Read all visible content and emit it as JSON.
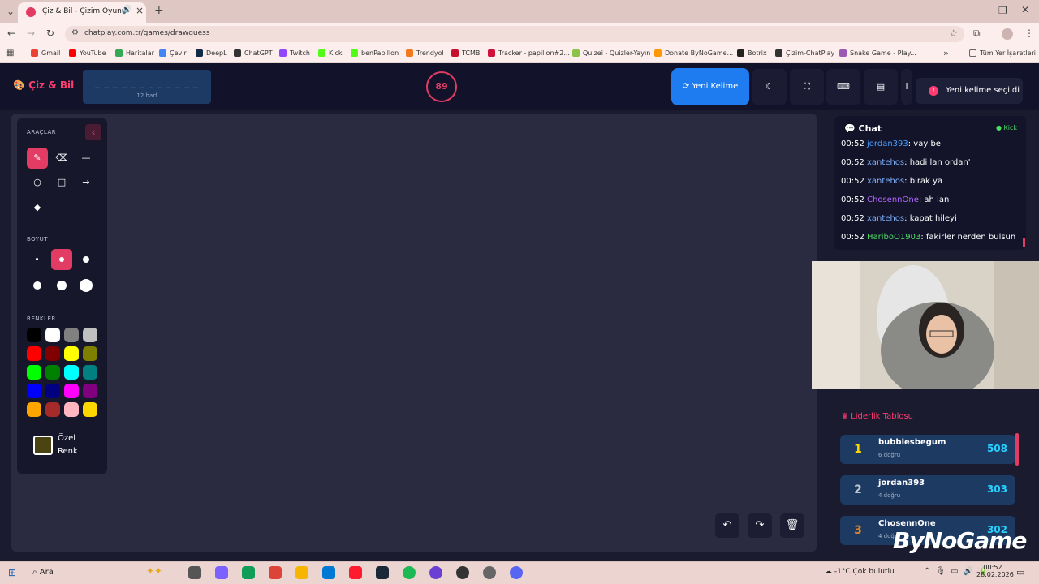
{
  "browser": {
    "tab_title": "Çiz & Bil - Çizim Oyunu",
    "url": "chatplay.com.tr/games/drawguess",
    "bookmarks": [
      "Gmail",
      "YouTube",
      "Haritalar",
      "Çevir",
      "DeepL",
      "ChatGPT",
      "Twitch",
      "Kick",
      "benPapillon",
      "Trendyol",
      "TCMB",
      "Tracker - papillon#2...",
      "Quizei - Quizler-Yayın",
      "Donate ByNoGame...",
      "Botrix",
      "Çizim-ChatPlay",
      "Snake Game - Play..."
    ],
    "all_bookmarks": "Tüm Yer İşaretleri"
  },
  "header": {
    "logo": "Çiz & Bil",
    "word_mask": "_ _ _ _ _ _ _ _ _ _ _ _",
    "word_hint": "12 harf",
    "timer": "89",
    "new_word_label": "Yeni Kelime",
    "toast": "Yeni kelime seçildi"
  },
  "tools": {
    "tools_label": "ARAÇLAR",
    "size_label": "BOYUT",
    "colors_label": "RENKLER",
    "custom_color_label": "Özel Renk",
    "palette": [
      "#000000",
      "#ffffff",
      "#808080",
      "#c0c0c0",
      "#ff0000",
      "#800000",
      "#ffff00",
      "#808000",
      "#00ff00",
      "#008000",
      "#00ffff",
      "#008080",
      "#0000ff",
      "#000080",
      "#ff00ff",
      "#800080",
      "#ffa500",
      "#a52a2a",
      "#ffb6c1",
      "#ffd700"
    ]
  },
  "chat": {
    "title": "Chat",
    "platform": "Kick",
    "messages": [
      {
        "time": "00:52",
        "user": "jordan393",
        "text": ": vay be",
        "color": "#4a9eff"
      },
      {
        "time": "00:52",
        "user": "xantehos",
        "text": ": hadi lan ordan'",
        "color": "#7db3ff"
      },
      {
        "time": "00:52",
        "user": "xantehos",
        "text": ": birak ya",
        "color": "#7db3ff"
      },
      {
        "time": "00:52",
        "user": "ChosennOne",
        "text": ": ah lan",
        "color": "#b366ff"
      },
      {
        "time": "00:52",
        "user": "xantehos",
        "text": ": kapat hileyi",
        "color": "#7db3ff"
      },
      {
        "time": "00:52",
        "user": "HariboO1903",
        "text": ": fakirler nerden bulsun",
        "color": "#4cd964"
      }
    ]
  },
  "leaderboard": {
    "title": "Liderlik Tablosu",
    "rows": [
      {
        "rank": "1",
        "name": "bubblesbegum",
        "correct": "6 doğru",
        "score": "508",
        "rank_color": "#ffd700"
      },
      {
        "rank": "2",
        "name": "jordan393",
        "correct": "4 doğru",
        "score": "303",
        "rank_color": "#c0c6d0"
      },
      {
        "rank": "3",
        "name": "ChosennOne",
        "correct": "4 doğru",
        "score": "302",
        "rank_color": "#d9822b"
      }
    ]
  },
  "watermark": "ByNoGame",
  "taskbar": {
    "search": "Ara",
    "weather": "-1°C  Çok bulutlu",
    "time": "00:52",
    "date": "28.02.2026"
  }
}
